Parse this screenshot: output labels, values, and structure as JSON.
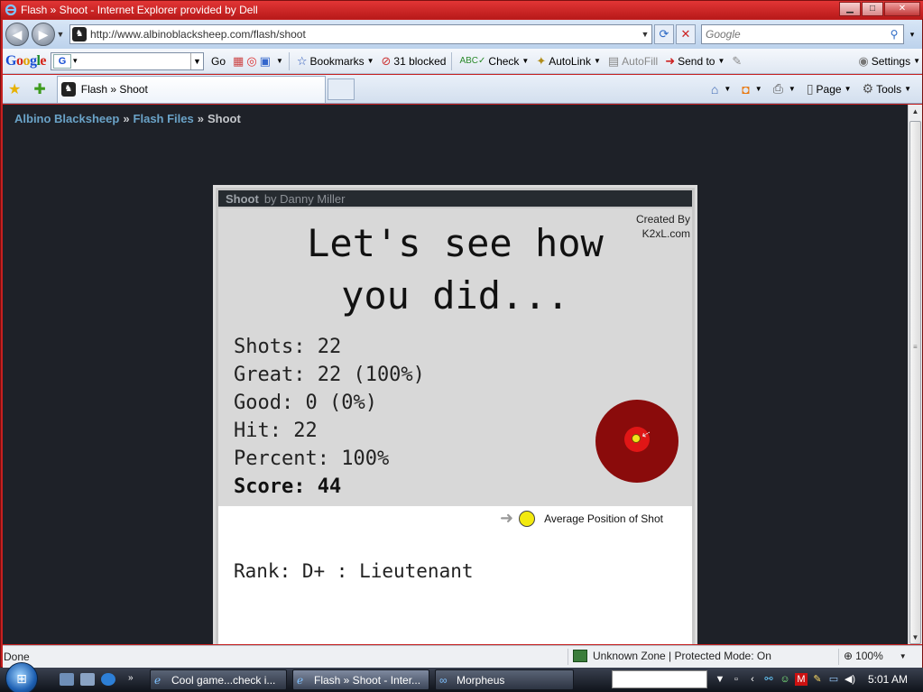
{
  "window": {
    "title": "Flash » Shoot - Internet Explorer provided by Dell",
    "controls": {
      "minimize": "▁",
      "maximize": "□",
      "close": "✕"
    }
  },
  "address": {
    "url": "http://www.albinoblacksheep.com/flash/shoot",
    "search_placeholder": "Google"
  },
  "google_toolbar": {
    "go": "Go",
    "bookmarks": "Bookmarks",
    "blocked": "31 blocked",
    "check": "Check",
    "autolink": "AutoLink",
    "autofill": "AutoFill",
    "send_to": "Send to",
    "settings": "Settings"
  },
  "tab": {
    "label": "Flash » Shoot"
  },
  "command_bar": {
    "page": "Page",
    "tools": "Tools"
  },
  "breadcrumb": {
    "site": "Albino Blacksheep",
    "section": "Flash Files",
    "current": "Shoot",
    "separator": "»"
  },
  "flash": {
    "header_title": "Shoot",
    "header_author": "by Danny Miller",
    "credit_line1": "Created By",
    "credit_line2": "K2xL.com",
    "headline_line1": "Let's see how",
    "headline_line2": "you did...",
    "stats": {
      "shots": "Shots: 22",
      "great": "Great: 22 (100%)",
      "good": "Good: 0 (0%)",
      "hit": "Hit: 22",
      "percent": "Percent: 100%",
      "score": "Score: 44"
    },
    "legend": "Average Position of Shot",
    "rank": "Rank: D+ : Lieutenant"
  },
  "status": {
    "text": "Done",
    "zone": "Unknown Zone | Protected Mode: On",
    "zoom": "100%"
  },
  "taskbar": {
    "tasks": [
      {
        "label": "Cool game...check i..."
      },
      {
        "label": "Flash » Shoot - Inter..."
      },
      {
        "label": "Morpheus"
      }
    ],
    "clock": "5:01 AM"
  }
}
